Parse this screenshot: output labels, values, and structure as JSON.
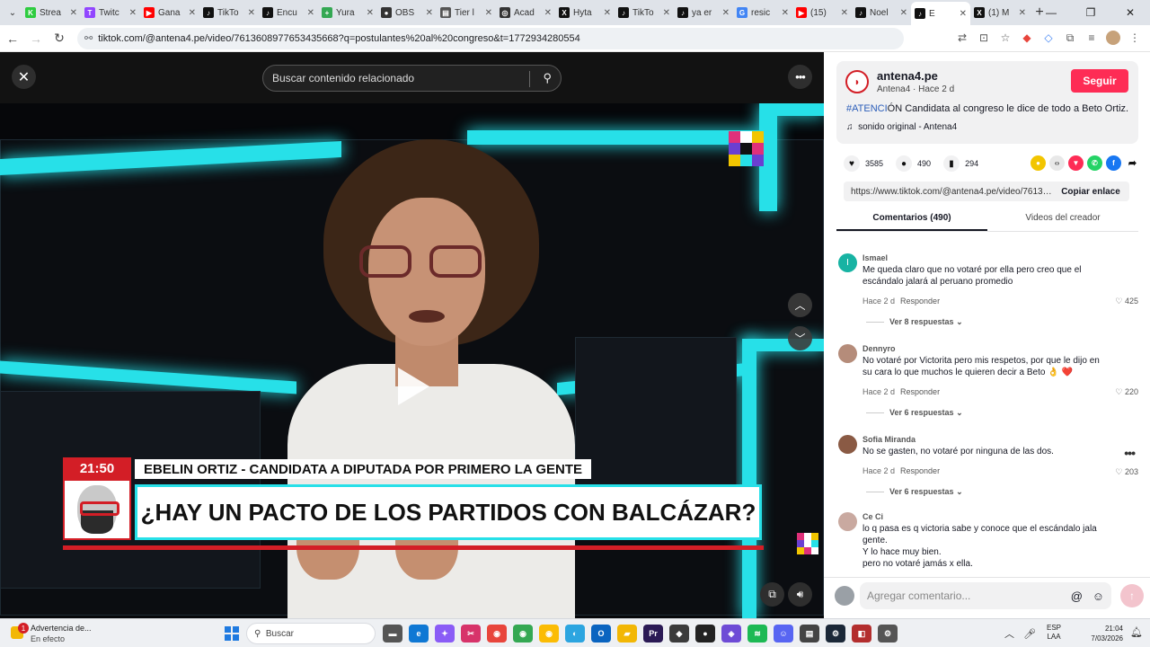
{
  "browser": {
    "tabs": [
      {
        "label": "Strea",
        "fav": "K",
        "color": "#2ecc40"
      },
      {
        "label": "Twitc",
        "fav": "T",
        "color": "#9146ff"
      },
      {
        "label": "Gana",
        "fav": "▶",
        "color": "#ff0000"
      },
      {
        "label": "TikTo",
        "fav": "♪",
        "color": "#111111"
      },
      {
        "label": "Encu",
        "fav": "♪",
        "color": "#111111"
      },
      {
        "label": "Yura",
        "fav": "+",
        "color": "#34a853"
      },
      {
        "label": "OBS",
        "fav": "●",
        "color": "#333333"
      },
      {
        "label": "Tier l",
        "fav": "▤",
        "color": "#555555"
      },
      {
        "label": "Acad",
        "fav": "◎",
        "color": "#333333"
      },
      {
        "label": "Hyta",
        "fav": "X",
        "color": "#111111"
      },
      {
        "label": "TikTo",
        "fav": "♪",
        "color": "#111111"
      },
      {
        "label": "ya er",
        "fav": "♪",
        "color": "#111111"
      },
      {
        "label": "resic",
        "fav": "G",
        "color": "#4285f4"
      },
      {
        "label": "(15)",
        "fav": "▶",
        "color": "#ff0000"
      },
      {
        "label": "Noel",
        "fav": "♪",
        "color": "#111111"
      },
      {
        "label": "E",
        "fav": "♪",
        "color": "#111111"
      },
      {
        "label": "(1) M",
        "fav": "X",
        "color": "#111111"
      }
    ],
    "active_tab_index": 15,
    "new_tab": "+",
    "url": "tiktok.com/@antena4.pe/video/7613608977653435668?q=postulantes%20al%20congreso&t=1772934280554"
  },
  "video": {
    "search_placeholder": "Buscar contenido relacionado",
    "close_icon": "✕",
    "more_icon": "•••",
    "lower_third": {
      "time": "21:50",
      "name": "EBELIN ORTIZ - CANDIDATA A DIPUTADA POR PRIMERO LA GENTE",
      "question": "¿HAY UN PACTO DE LOS PARTIDOS CON BALCÁZAR?"
    },
    "colors": {
      "neon": "#27e0e8",
      "brand_red": "#d31e26"
    }
  },
  "post": {
    "account": "antena4.pe",
    "subtitle": "Antena4 · Hace 2 d",
    "follow_label": "Seguir",
    "caption_tag": "#ATENCI",
    "caption_rest": "ÓN Candidata al congreso le dice de todo a Beto Ortiz.",
    "sound": "sonido original - Antena4",
    "likes": "3585",
    "comments": "490",
    "saves": "294",
    "link": "https://www.tiktok.com/@antena4.pe/video/76136...",
    "copy_label": "Copiar enlace",
    "tab_comments": "Comentarios (490)",
    "tab_creator": "Videos del creador"
  },
  "comments": [
    {
      "user": "Ismael",
      "avatar": "I",
      "avatar_color": "#17b3a3",
      "text": "Me queda claro que no votaré por ella pero creo que el escándalo jalará al peruano promedio",
      "time": "Hace 2 d",
      "reply": "Responder",
      "likes": "425",
      "replies": "Ver 8 respuestas"
    },
    {
      "user": "Dennyro",
      "avatar": "",
      "avatar_color": "#b58c7a",
      "text": "No votaré por Victorita pero mis respetos, por que le dijo en su cara lo que muchos le quieren decir a Beto 👌 ❤️",
      "time": "Hace 2 d",
      "reply": "Responder",
      "likes": "220",
      "replies": "Ver 6 respuestas"
    },
    {
      "user": "Sofia Miranda",
      "avatar": "",
      "avatar_color": "#8a5a44",
      "text": "No se gasten, no votaré por ninguna de las dos.",
      "time": "Hace 2 d",
      "reply": "Responder",
      "likes": "203",
      "replies": "Ver 6 respuestas"
    },
    {
      "user": "Ce Ci",
      "avatar": "",
      "avatar_color": "#c9a9a0",
      "text": "lo q pasa es q victoria sabe y conoce que el escándalo jala gente.\nY lo hace muy bien.\npero no votaré jamás x ella.",
      "time": "",
      "reply": "",
      "likes": "",
      "replies": ""
    }
  ],
  "comment_input": {
    "placeholder": "Agregar comentario..."
  },
  "taskbar": {
    "notice_title": "Advertencia de...",
    "notice_sub": "En efecto",
    "search_label": "Buscar",
    "lang_top": "ESP",
    "lang_bottom": "LAA",
    "time": "21:04",
    "date": "7/03/2026",
    "apps": [
      {
        "icon": "folder-icon",
        "glyph": "▬",
        "color": "#555555"
      },
      {
        "icon": "edge-icon",
        "glyph": "e",
        "color": "#0f78d4"
      },
      {
        "icon": "copilot-icon",
        "glyph": "✦",
        "color": "#8a5cf6"
      },
      {
        "icon": "snip-icon",
        "glyph": "✂",
        "color": "#d7336a"
      },
      {
        "icon": "chrome-icon",
        "glyph": "◉",
        "color": "#e8453c"
      },
      {
        "icon": "chrome-icon",
        "glyph": "◉",
        "color": "#34a853"
      },
      {
        "icon": "chrome-icon",
        "glyph": "◉",
        "color": "#fbbc05"
      },
      {
        "icon": "app-icon",
        "glyph": "◐",
        "color": "#2ca5e0"
      },
      {
        "icon": "outlook-icon",
        "glyph": "O",
        "color": "#0a64c0"
      },
      {
        "icon": "explorer-icon",
        "glyph": "▰",
        "color": "#f2b705"
      },
      {
        "icon": "premiere-icon",
        "glyph": "Pr",
        "color": "#2b1a55"
      },
      {
        "icon": "app-icon",
        "glyph": "◆",
        "color": "#3b3b3b"
      },
      {
        "icon": "obs-icon",
        "glyph": "●",
        "color": "#222222"
      },
      {
        "icon": "app-icon",
        "glyph": "◈",
        "color": "#6e4bd6"
      },
      {
        "icon": "spotify-icon",
        "glyph": "≋",
        "color": "#1db954"
      },
      {
        "icon": "discord-icon",
        "glyph": "☺",
        "color": "#5865f2"
      },
      {
        "icon": "notes-icon",
        "glyph": "▤",
        "color": "#444444"
      },
      {
        "icon": "steam-icon",
        "glyph": "⚙",
        "color": "#1b2838"
      },
      {
        "icon": "app-icon",
        "glyph": "◧",
        "color": "#b32e2e"
      },
      {
        "icon": "settings-icon",
        "glyph": "⚙",
        "color": "#555555"
      }
    ]
  }
}
